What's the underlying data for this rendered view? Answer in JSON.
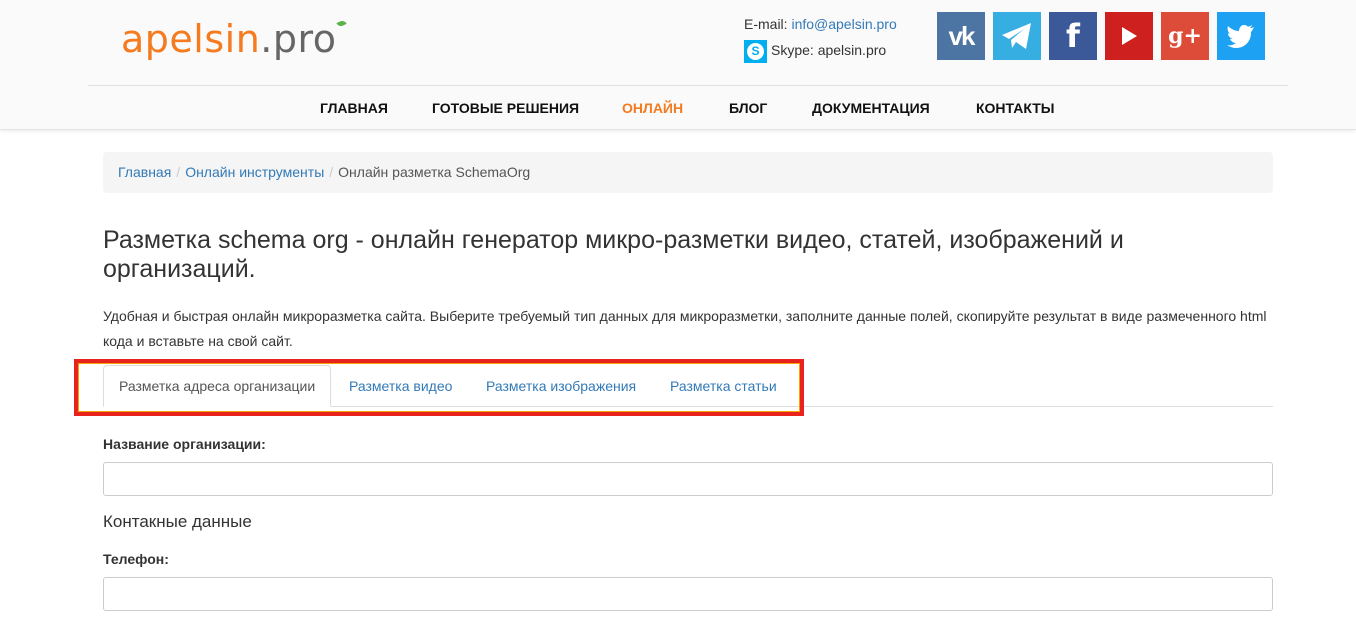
{
  "header": {
    "logo": {
      "part1": "apelsin",
      "part2": ".pro"
    },
    "email_label": "E-mail: ",
    "email": "info@apelsin.pro",
    "skype": "Skype: apelsin.pro",
    "social": [
      {
        "name": "vk",
        "glyph": "vk",
        "color": "#4c75a3"
      },
      {
        "name": "telegram",
        "glyph": "",
        "color": "#37aee2"
      },
      {
        "name": "facebook",
        "glyph": "f",
        "color": "#3b5998"
      },
      {
        "name": "youtube",
        "glyph": "",
        "color": "#cd201f"
      },
      {
        "name": "google-plus",
        "glyph": "g+",
        "color": "#dd4b39"
      },
      {
        "name": "twitter",
        "glyph": "",
        "color": "#1da1f2"
      }
    ]
  },
  "nav": {
    "items": [
      {
        "label": "ГЛАВНАЯ"
      },
      {
        "label": "ГОТОВЫЕ РЕШЕНИЯ"
      },
      {
        "label": "ОНЛАЙН"
      },
      {
        "label": "БЛОГ"
      },
      {
        "label": "ДОКУМЕНТАЦИЯ"
      },
      {
        "label": "КОНТАКТЫ"
      }
    ],
    "active": "ОНЛАЙН",
    "accent_color": "#f47b20"
  },
  "breadcrumb": {
    "items": [
      "Главная",
      "Онлайн инструменты",
      "Онлайн разметка SchemaOrg"
    ],
    "separator": "/"
  },
  "page": {
    "title": "Разметка schema org - онлайн генератор микро-разметки видео, статей, изображений и организаций.",
    "description": "Удобная и быстрая онлайн микроразметка сайта. Выберите требуемый тип данных для микроразметки, заполните данные полей, скопируйте результат в виде размеченного html кода и вставьте на свой сайт."
  },
  "tabs": {
    "items": [
      {
        "label": "Разметка адреса организации"
      },
      {
        "label": "Разметка видео"
      },
      {
        "label": "Разметка изображения"
      },
      {
        "label": "Разметка статьи"
      }
    ],
    "active": "Разметка адреса организации"
  },
  "form": {
    "org_name_label": "Название организации:",
    "org_name_value": "",
    "contact_heading": "Контакные данные",
    "phone_label": "Телефон:",
    "phone_value": ""
  }
}
